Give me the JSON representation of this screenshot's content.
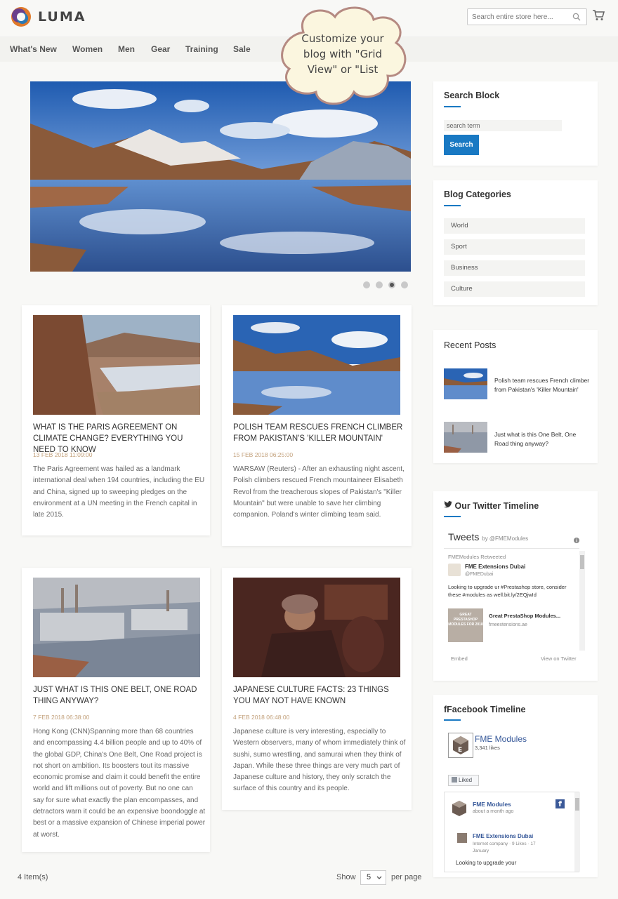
{
  "header": {
    "logo_text": "LUMA",
    "search_placeholder": "Search entire store here..."
  },
  "nav": {
    "items": [
      "What's New",
      "Women",
      "Men",
      "Gear",
      "Training",
      "Sale"
    ]
  },
  "callout": {
    "lines": [
      "Customize your",
      "blog with \"Grid",
      "View\" or \"List"
    ]
  },
  "slider": {
    "dot_count": 4,
    "active_index": 2
  },
  "posts": [
    {
      "title": "WHAT IS THE PARIS AGREEMENT ON CLIMATE CHANGE? EVERYTHING YOU NEED TO KNOW",
      "date": "13 FEB 2018 11:09:00",
      "excerpt": "The Paris Agreement was hailed as a landmark international deal when 194 countries, including the EU and China, signed up to sweeping pledges on the environment at a UN meeting in the French capital in late 2015."
    },
    {
      "title": "POLISH TEAM RESCUES FRENCH CLIMBER FROM PAKISTAN'S 'KILLER MOUNTAIN'",
      "date": "15 FEB 2018 06:25:00",
      "excerpt": "WARSAW (Reuters) - After an exhausting night ascent, Polish climbers rescued French mountaineer Elisabeth Revol from the treacherous slopes of Pakistan's \"Killer Mountain\" but were unable to save her climbing companion. Poland's winter climbing team said."
    },
    {
      "title": "JUST WHAT IS THIS ONE BELT, ONE ROAD THING ANYWAY?",
      "date": "7 FEB 2018 06:38:00",
      "excerpt": "Hong Kong (CNN)Spanning more than 68 countries and encompassing 4.4 billion people and up to 40% of the global GDP, China's One Belt, One Road project is not short on ambition. Its boosters tout its massive economic promise and claim it could benefit the entire world and lift millions out of poverty. But no one can say for sure what exactly the plan encompasses, and detractors warn it could be an expensive boondoggle at best or a massive expansion of Chinese imperial power at worst."
    },
    {
      "title": "JAPANESE CULTURE FACTS: 23 THINGS YOU MAY NOT HAVE KNOWN",
      "date": "4 FEB 2018 06:48:00",
      "excerpt": "Japanese culture is very interesting, especially to Western observers, many of whom immediately think of sushi, sumo wrestling, and samurai when they think of Japan. While these three things are very much part of Japanese culture and history, they only scratch the surface of this country and its people."
    }
  ],
  "toolbar": {
    "item_count": "4 Item(s)",
    "show_label": "Show",
    "page_size": "5",
    "per_page_label": "per page"
  },
  "sidebar": {
    "search_block": {
      "title": "Search Block",
      "placeholder": "search term",
      "button": "Search"
    },
    "categories": {
      "title": "Blog Categories",
      "items": [
        "World",
        "Sport",
        "Business",
        "Culture"
      ]
    },
    "recent_posts": {
      "title": "Recent Posts",
      "items": [
        "Polish team rescues French climber from Pakistan's 'Killer Mountain'",
        "Just what is this One Belt, One Road thing anyway?"
      ]
    },
    "twitter": {
      "title": "Our Twitter Timeline",
      "tweets_label": "Tweets",
      "by_label": "by @FMEModules",
      "retweeted": "FMEModules Retweeted",
      "author": "FME Extensions Dubai",
      "handle": "@FMEDubai",
      "text": "Looking to upgrade ur #Prestashop store, consider these #modules as well.bit.ly/2EQjwId",
      "card_image_text": "GREAT PRESTASHOP MODULES FOR 2018",
      "card_title": "Great PrestaShop Modules...",
      "card_domain": "fmeextensions.ae",
      "embed": "Embed",
      "view_on": "View on Twitter"
    },
    "facebook": {
      "title": "Facebook Timeline",
      "page_name": "FME Modules",
      "likes": "3,341 likes",
      "liked_button": "Liked",
      "post_author": "FME Modules",
      "post_time": "about a month ago",
      "shared_name": "FME Extensions Dubai",
      "shared_meta_1": "Internet company · 9 Likes · 17",
      "shared_meta_2": "January",
      "post_text": "Looking to upgrade your"
    }
  },
  "colors": {
    "accent": "#1979c3",
    "date": "#c2a07a"
  }
}
